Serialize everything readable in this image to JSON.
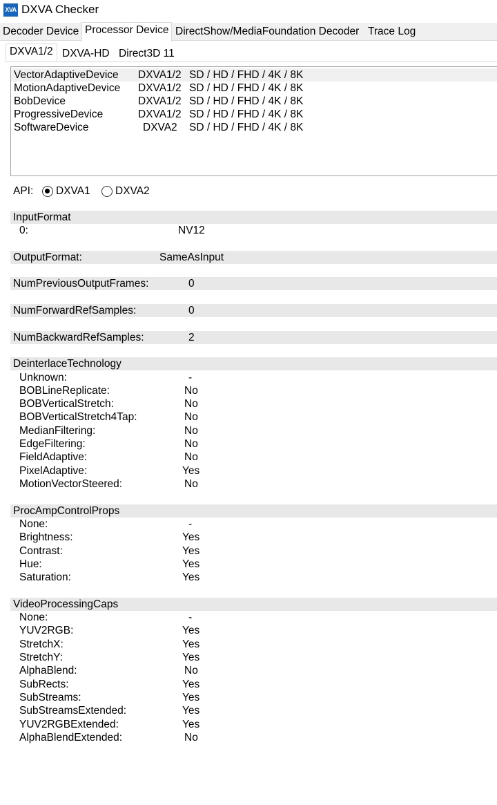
{
  "window": {
    "icon_text": "XVA",
    "title": "DXVA Checker"
  },
  "main_tabs": [
    "Decoder Device",
    "Processor Device",
    "DirectShow/MediaFoundation Decoder",
    "Trace Log"
  ],
  "sub_tabs": [
    "DXVA1/2",
    "DXVA-HD",
    "Direct3D 11"
  ],
  "devices": [
    {
      "name": "VectorAdaptiveDevice",
      "api": "DXVA1/2",
      "res": "SD / HD / FHD / 4K / 8K"
    },
    {
      "name": "MotionAdaptiveDevice",
      "api": "DXVA1/2",
      "res": "SD / HD / FHD / 4K / 8K"
    },
    {
      "name": "BobDevice",
      "api": "DXVA1/2",
      "res": "SD / HD / FHD / 4K / 8K"
    },
    {
      "name": "ProgressiveDevice",
      "api": "DXVA1/2",
      "res": "SD / HD / FHD / 4K / 8K"
    },
    {
      "name": "SoftwareDevice",
      "api": "DXVA2",
      "res": "SD / HD / FHD / 4K / 8K"
    }
  ],
  "api": {
    "label": "API:",
    "option1": "DXVA1",
    "option2": "DXVA2",
    "selected": "DXVA1"
  },
  "input_format": {
    "header": "InputFormat",
    "rows": [
      {
        "k": "0:",
        "v": "NV12"
      }
    ]
  },
  "output_format": {
    "label": "OutputFormat:",
    "value": "SameAsInput"
  },
  "num_prev_output_frames": {
    "label": "NumPreviousOutputFrames:",
    "value": "0"
  },
  "num_forward_ref": {
    "label": "NumForwardRefSamples:",
    "value": "0"
  },
  "num_backward_ref": {
    "label": "NumBackwardRefSamples:",
    "value": "2"
  },
  "deinterlace": {
    "header": "DeinterlaceTechnology",
    "rows": [
      {
        "k": "Unknown:",
        "v": "-"
      },
      {
        "k": "BOBLineReplicate:",
        "v": "No"
      },
      {
        "k": "BOBVerticalStretch:",
        "v": "No"
      },
      {
        "k": "BOBVerticalStretch4Tap:",
        "v": "No"
      },
      {
        "k": "MedianFiltering:",
        "v": "No"
      },
      {
        "k": "EdgeFiltering:",
        "v": "No"
      },
      {
        "k": "FieldAdaptive:",
        "v": "No"
      },
      {
        "k": "PixelAdaptive:",
        "v": "Yes"
      },
      {
        "k": "MotionVectorSteered:",
        "v": "No"
      }
    ]
  },
  "procamp": {
    "header": "ProcAmpControlProps",
    "rows": [
      {
        "k": "None:",
        "v": "-"
      },
      {
        "k": "Brightness:",
        "v": "Yes"
      },
      {
        "k": "Contrast:",
        "v": "Yes"
      },
      {
        "k": "Hue:",
        "v": "Yes"
      },
      {
        "k": "Saturation:",
        "v": "Yes"
      }
    ]
  },
  "vp_caps": {
    "header": "VideoProcessingCaps",
    "rows": [
      {
        "k": "None:",
        "v": "-"
      },
      {
        "k": "YUV2RGB:",
        "v": "Yes"
      },
      {
        "k": "StretchX:",
        "v": "Yes"
      },
      {
        "k": "StretchY:",
        "v": "Yes"
      },
      {
        "k": "AlphaBlend:",
        "v": "No"
      },
      {
        "k": "SubRects:",
        "v": "Yes"
      },
      {
        "k": "SubStreams:",
        "v": "Yes"
      },
      {
        "k": "SubStreamsExtended:",
        "v": "Yes"
      },
      {
        "k": "YUV2RGBExtended:",
        "v": "Yes"
      },
      {
        "k": "AlphaBlendExtended:",
        "v": "No"
      }
    ]
  }
}
